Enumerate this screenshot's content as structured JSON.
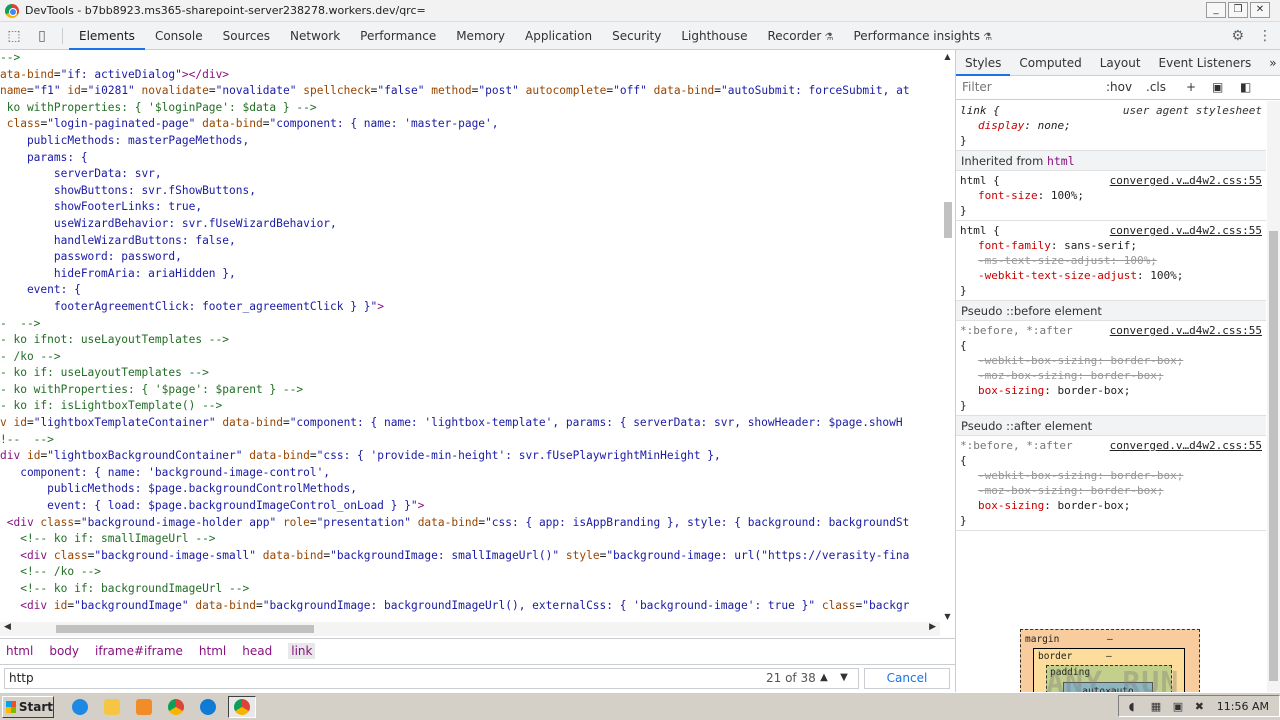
{
  "window": {
    "title": "DevTools - b7bb8923.ms365-sharepoint-server238278.workers.dev/qrc="
  },
  "devtools_tabs": [
    {
      "label": "Elements",
      "active": true
    },
    {
      "label": "Console"
    },
    {
      "label": "Sources"
    },
    {
      "label": "Network"
    },
    {
      "label": "Performance"
    },
    {
      "label": "Memory"
    },
    {
      "label": "Application"
    },
    {
      "label": "Security"
    },
    {
      "label": "Lighthouse"
    },
    {
      "label": "Recorder",
      "experimental": true
    },
    {
      "label": "Performance insights",
      "experimental": true
    }
  ],
  "elements": {
    "lines": [
      [
        [
          "com",
          "-->"
        ]
      ],
      [
        [
          "attr",
          "ata-bind"
        ],
        [
          "txt",
          "="
        ],
        [
          "val",
          "\"if: activeDialog\""
        ],
        [
          "tag",
          "></div>"
        ]
      ],
      [
        [
          "attr",
          "name"
        ],
        [
          "txt",
          "="
        ],
        [
          "val",
          "\"f1\""
        ],
        [
          "txt",
          " "
        ],
        [
          "attr",
          "id"
        ],
        [
          "txt",
          "="
        ],
        [
          "val",
          "\"i0281\""
        ],
        [
          "txt",
          " "
        ],
        [
          "attr",
          "novalidate"
        ],
        [
          "txt",
          "="
        ],
        [
          "val",
          "\"novalidate\""
        ],
        [
          "txt",
          " "
        ],
        [
          "attr",
          "spellcheck"
        ],
        [
          "txt",
          "="
        ],
        [
          "val",
          "\"false\""
        ],
        [
          "txt",
          " "
        ],
        [
          "attr",
          "method"
        ],
        [
          "txt",
          "="
        ],
        [
          "val",
          "\"post\""
        ],
        [
          "txt",
          " "
        ],
        [
          "attr",
          "autocomplete"
        ],
        [
          "txt",
          "="
        ],
        [
          "val",
          "\"off\""
        ],
        [
          "txt",
          " "
        ],
        [
          "attr",
          "data-bind"
        ],
        [
          "txt",
          "="
        ],
        [
          "val",
          "\"autoSubmit: forceSubmit, at"
        ]
      ],
      [
        [
          "com",
          " ko withProperties: { '$loginPage': $data } -->"
        ]
      ],
      [
        [
          "txt",
          " "
        ],
        [
          "attr",
          "class"
        ],
        [
          "txt",
          "="
        ],
        [
          "val",
          "\"login-paginated-page\""
        ],
        [
          "txt",
          " "
        ],
        [
          "attr",
          "data-bind"
        ],
        [
          "txt",
          "="
        ],
        [
          "val",
          "\"component: { name: 'master-page',"
        ]
      ],
      [
        [
          "val",
          "    publicMethods: masterPageMethods,"
        ]
      ],
      [
        [
          "val",
          "    params: {"
        ]
      ],
      [
        [
          "val",
          "        serverData: svr,"
        ]
      ],
      [
        [
          "val",
          "        showButtons: svr.fShowButtons,"
        ]
      ],
      [
        [
          "val",
          "        showFooterLinks: true,"
        ]
      ],
      [
        [
          "val",
          "        useWizardBehavior: svr.fUseWizardBehavior,"
        ]
      ],
      [
        [
          "val",
          "        handleWizardButtons: false,"
        ]
      ],
      [
        [
          "val",
          "        password: password,"
        ]
      ],
      [
        [
          "val",
          "        hideFromAria: ariaHidden },"
        ]
      ],
      [
        [
          "val",
          "    event: {"
        ]
      ],
      [
        [
          "val",
          "        footerAgreementClick: footer_agreementClick } }\""
        ],
        [
          "tag",
          ">"
        ]
      ],
      [
        [
          "com",
          "-  -->"
        ]
      ],
      [
        [
          "com",
          "- ko ifnot: useLayoutTemplates -->"
        ]
      ],
      [
        [
          "com",
          "- /ko -->"
        ]
      ],
      [
        [
          "com",
          "- ko if: useLayoutTemplates -->"
        ]
      ],
      [
        [
          "com",
          "- ko withProperties: { '$page': $parent } -->"
        ]
      ],
      [
        [
          "com",
          "- ko if: isLightboxTemplate() -->"
        ]
      ],
      [
        [
          "attr",
          "v id"
        ],
        [
          "txt",
          "="
        ],
        [
          "val",
          "\"lightboxTemplateContainer\""
        ],
        [
          "txt",
          " "
        ],
        [
          "attr",
          "data-bind"
        ],
        [
          "txt",
          "="
        ],
        [
          "val",
          "\"component: { name: 'lightbox-template', params: { serverData: svr, showHeader: $page.showH"
        ]
      ],
      [
        [
          "com",
          "!--  -->"
        ]
      ],
      [
        [
          "tag",
          "div "
        ],
        [
          "attr",
          "id"
        ],
        [
          "txt",
          "="
        ],
        [
          "val",
          "\"lightboxBackgroundContainer\""
        ],
        [
          "txt",
          " "
        ],
        [
          "attr",
          "data-bind"
        ],
        [
          "txt",
          "="
        ],
        [
          "val",
          "\"css: { 'provide-min-height': svr.fUsePlaywrightMinHeight },"
        ]
      ],
      [
        [
          "val",
          "   component: { name: 'background-image-control',"
        ]
      ],
      [
        [
          "val",
          "       publicMethods: $page.backgroundControlMethods,"
        ]
      ],
      [
        [
          "val",
          "       event: { load: $page.backgroundImageControl_onLoad } }\""
        ],
        [
          "tag",
          ">"
        ]
      ],
      [
        [
          "tag",
          " <div "
        ],
        [
          "attr",
          "class"
        ],
        [
          "txt",
          "="
        ],
        [
          "val",
          "\"background-image-holder app\""
        ],
        [
          "txt",
          " "
        ],
        [
          "attr",
          "role"
        ],
        [
          "txt",
          "="
        ],
        [
          "val",
          "\"presentation\""
        ],
        [
          "txt",
          " "
        ],
        [
          "attr",
          "data-bind"
        ],
        [
          "txt",
          "="
        ],
        [
          "val",
          "\"css: { app: isAppBranding }, style: { background: backgroundSt"
        ]
      ],
      [
        [
          "com",
          "   <!-- ko if: smallImageUrl -->"
        ]
      ],
      [
        [
          "tag",
          "   <div "
        ],
        [
          "attr",
          "class"
        ],
        [
          "txt",
          "="
        ],
        [
          "val",
          "\"background-image-small\""
        ],
        [
          "txt",
          " "
        ],
        [
          "attr",
          "data-bind"
        ],
        [
          "txt",
          "="
        ],
        [
          "val",
          "\"backgroundImage: smallImageUrl()\""
        ],
        [
          "txt",
          " "
        ],
        [
          "attr",
          "style"
        ],
        [
          "txt",
          "="
        ],
        [
          "val",
          "\"background-image: url(\"https://verasity-fina"
        ]
      ],
      [
        [
          "com",
          "   <!-- /ko -->"
        ]
      ],
      [
        [
          "com",
          "   <!-- ko if: backgroundImageUrl -->"
        ]
      ],
      [
        [
          "tag",
          "   <div "
        ],
        [
          "attr",
          "id"
        ],
        [
          "txt",
          "="
        ],
        [
          "val",
          "\"backgroundImage\""
        ],
        [
          "txt",
          " "
        ],
        [
          "attr",
          "data-bind"
        ],
        [
          "txt",
          "="
        ],
        [
          "val",
          "\"backgroundImage: backgroundImageUrl(), externalCss: { 'background-image': true }\""
        ],
        [
          "txt",
          " "
        ],
        [
          "attr",
          "class"
        ],
        [
          "txt",
          "="
        ],
        [
          "val",
          "\"backgr"
        ]
      ]
    ]
  },
  "breadcrumbs": [
    "html",
    "body",
    "iframe#iframe",
    "html",
    "head",
    "link"
  ],
  "search": {
    "value": "http",
    "count": "21 of 38",
    "cancel_label": "Cancel"
  },
  "styles_panel": {
    "tabs": [
      "Styles",
      "Computed",
      "Layout",
      "Event Listeners"
    ],
    "filter_placeholder": "Filter",
    "hov_label": ":hov",
    "cls_label": ".cls",
    "ua_rule": {
      "selector": "link {",
      "source": "user agent stylesheet",
      "prop": "display",
      "value": "none;"
    },
    "inherited_label": "Inherited from",
    "inherited_from": "html",
    "html_rule1": {
      "selector": "html {",
      "source": "converged.v…d4w2.css:55",
      "prop": "font-size",
      "value": "100%;"
    },
    "html_rule2": {
      "selector": "html {",
      "source": "converged.v…d4w2.css:55",
      "p1": "font-family",
      "v1": "sans-serif;",
      "p2": "-ms-text-size-adjust",
      "v2": "100%;",
      "p3": "-webkit-text-size-adjust",
      "v3": "100%;"
    },
    "pseudo_before_label": "Pseudo ::before element",
    "pseudo_after_label": "Pseudo ::after element",
    "pseudo_rule": {
      "selector": "*:before, *:after",
      "source": "converged.v…d4w2.css:55",
      "p1": "-webkit-box-sizing",
      "v1": "border-box;",
      "p2": "-moz-box-sizing",
      "v2": "border-box;",
      "p3": "box-sizing",
      "v3": "border-box;"
    },
    "box_model": {
      "margin": "margin",
      "border": "border",
      "padding": "padding",
      "content": "auto×auto",
      "dash": "–"
    }
  },
  "watermark": "ANY.RUN",
  "taskbar": {
    "start_label": "Start",
    "clock": "11:56 AM"
  }
}
